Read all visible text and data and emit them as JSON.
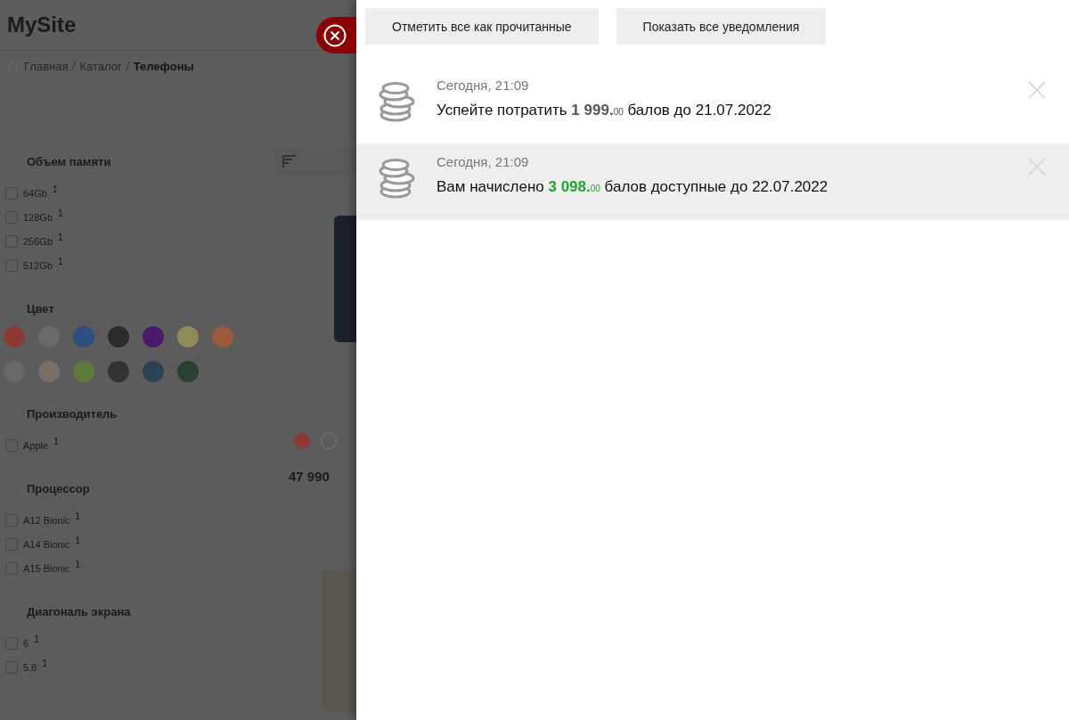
{
  "site": {
    "logo": "MySite",
    "breadcrumbs": [
      {
        "label": "Главная",
        "current": false
      },
      {
        "label": "Каталог",
        "current": false
      },
      {
        "label": "Телефоны",
        "current": true
      }
    ],
    "filters": [
      {
        "kind": "checks",
        "title": "Объем памяти",
        "options": [
          {
            "label": "64Gb",
            "count": "1",
            "checked": false
          },
          {
            "label": "128Gb",
            "count": "1",
            "checked": false
          },
          {
            "label": "256Gb",
            "count": "1",
            "checked": false
          },
          {
            "label": "512Gb",
            "count": "1",
            "checked": false
          }
        ]
      },
      {
        "kind": "colors",
        "title": "Цвет",
        "swatches": [
          {
            "color": "#8e3a34"
          },
          {
            "color": "#6a6a6a"
          },
          {
            "color": "#2f4f80"
          },
          {
            "color": "#2a2a2a"
          },
          {
            "color": "#4c1a6a"
          },
          {
            "color": "#8e8a5a"
          },
          {
            "color": "#9a5a3e"
          },
          {
            "color": "#686868"
          },
          {
            "color": "#7a6e66"
          },
          {
            "color": "#5d7a3a"
          },
          {
            "color": "#333333"
          },
          {
            "color": "#2a4454"
          },
          {
            "color": "#2a4030"
          }
        ]
      },
      {
        "kind": "checks",
        "title": "Производитель",
        "options": [
          {
            "label": "Apple",
            "count": "1",
            "checked": false
          }
        ]
      },
      {
        "kind": "checks",
        "title": "Процессор",
        "options": [
          {
            "label": "A12 Bionic",
            "count": "1",
            "checked": false
          },
          {
            "label": "A14 Bionic",
            "count": "1",
            "checked": false
          },
          {
            "label": "A15 Bionic",
            "count": "1",
            "checked": false
          }
        ]
      },
      {
        "kind": "checks",
        "title": "Диагональ экрана",
        "options": [
          {
            "label": "6",
            "count": "1",
            "checked": false
          },
          {
            "label": "5.8",
            "count": "1",
            "checked": false
          }
        ]
      }
    ],
    "product": {
      "price": "47 990"
    }
  },
  "panel": {
    "actions": [
      "Отметить все как прочитанные",
      "Показать все уведомления"
    ],
    "notifications": [
      {
        "time": "Сегодня, 21:09",
        "text_before": "Успейте потратить",
        "amount": "1 999.",
        "amount_fraction": "00",
        "kind": "spend",
        "text_after": "балов до 21.07.2022",
        "unread": false
      },
      {
        "time": "Сегодня, 21:09",
        "text_before": "Вам начислено",
        "amount": "3 098.",
        "amount_fraction": "00",
        "kind": "credit",
        "text_after": "балов доступные до 22.07.2022",
        "unread": true
      }
    ]
  }
}
